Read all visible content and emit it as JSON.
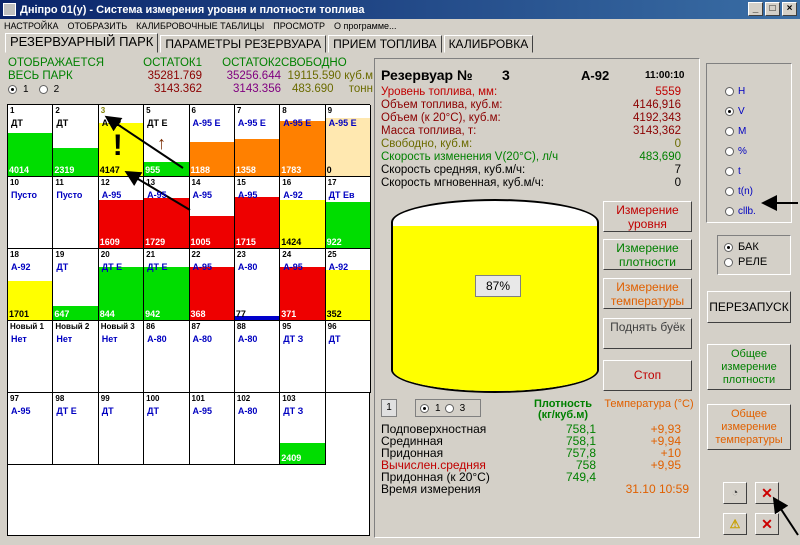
{
  "window": {
    "title": "Дніпро 01(у) - Система измерения уровня и плотности топлива",
    "minimize": "_",
    "maximize": "□",
    "close": "×"
  },
  "menu": [
    "НАСТРОЙКА",
    "ОТОБРАЗИТЬ",
    "КАЛИБРОВОЧНЫЕ ТАБЛИЦЫ",
    "ПРОСМОТР",
    "О программе..."
  ],
  "tabs": [
    "РЕЗЕРВУАРНЫЙ ПАРК",
    "ПАРАМЕТРЫ РЕЗЕРВУАРА",
    "ПРИЕМ ТОПЛИВА",
    "КАЛИБРОВКА"
  ],
  "summary": {
    "label_display": "ОТОБРАЖАЕТСЯ",
    "label_all": "ВЕСЬ ПАРК",
    "h_rest1": "ОСТАТОК1",
    "h_rest2": "ОСТАТОК2",
    "h_free": "СВОБОДНО",
    "radio1": "1",
    "radio2": "2",
    "v1": "35281.769",
    "v2": "35256.644",
    "v3": "19115.590",
    "u1": "куб.м",
    "w1": "3143.362",
    "w2": "3143.356",
    "w3": "483.690",
    "u2": "тонн"
  },
  "tanks": [
    {
      "n": "1",
      "f": "ДТ",
      "v": "4014",
      "fill": 0.6,
      "c": "#00dd00",
      "fc": "#000"
    },
    {
      "n": "2",
      "f": "ДТ",
      "v": "2319",
      "fill": 0.4,
      "c": "#00dd00",
      "fc": "#000"
    },
    {
      "n": "3",
      "f": "А-92",
      "v": "4147",
      "fill": 0.75,
      "c": "#ffff00",
      "fc": "#000",
      "hl": true
    },
    {
      "n": "5",
      "f": "ДТ Е",
      "v": "955",
      "fill": 0.2,
      "c": "#00dd00",
      "fc": "#000"
    },
    {
      "n": "6",
      "f": "А-95 Е",
      "v": "1188",
      "fill": 0.48,
      "c": "#ff8000",
      "fc": "#0000c0"
    },
    {
      "n": "7",
      "f": "А-95 Е",
      "v": "1358",
      "fill": 0.52,
      "c": "#ff8000",
      "fc": "#0000c0"
    },
    {
      "n": "8",
      "f": "А-95 Е",
      "v": "1783",
      "fill": 0.78,
      "c": "#ff8000",
      "fc": "#0000c0"
    },
    {
      "n": "",
      "f": "А-95 Е",
      "v": "",
      "fill": 0.78,
      "c": "#ff8000",
      "fc": "#0000c0",
      "hide": true
    },
    {
      "n": "9",
      "f": "А-95 Е",
      "v": "0",
      "fill": 0.82,
      "c": "#ffe8b0",
      "fc": "#0000c0"
    },
    {
      "n": "10",
      "f": "Пусто",
      "v": "",
      "fill": 0,
      "c": "#fff",
      "fc": "#0000c0"
    },
    {
      "n": "11",
      "f": "Пусто",
      "v": "",
      "fill": 0,
      "c": "#fff",
      "fc": "#0000c0"
    },
    {
      "n": "12",
      "f": "А-95",
      "v": "1609",
      "fill": 0.68,
      "c": "#ee0000",
      "fc": "#0000c0"
    },
    {
      "n": "13",
      "f": "А-95",
      "v": "1729",
      "fill": 0.7,
      "c": "#ee0000",
      "fc": "#0000c0"
    },
    {
      "n": "14",
      "f": "А-95",
      "v": "1005",
      "fill": 0.45,
      "c": "#ee0000",
      "fc": "#0000c0"
    },
    {
      "n": "15",
      "f": "А-95",
      "v": "1715",
      "fill": 0.72,
      "c": "#ee0000",
      "fc": "#0000c0"
    },
    {
      "n": "16",
      "f": "А-92",
      "v": "1424",
      "fill": 0.68,
      "c": "#ffff00",
      "fc": "#0000c0"
    },
    {
      "n": "17",
      "f": "ДТ Ев",
      "v": "922",
      "fill": 0.65,
      "c": "#00dd00",
      "fc": "#0000c0"
    },
    {
      "n": "18",
      "f": "А-92",
      "v": "1701",
      "fill": 0.55,
      "c": "#ffff00",
      "fc": "#0000c0"
    },
    {
      "n": "19",
      "f": "ДТ",
      "v": "647",
      "fill": 0.2,
      "c": "#00dd00",
      "fc": "#0000c0"
    },
    {
      "n": "20",
      "f": "ДТ Е",
      "v": "844",
      "fill": 0.75,
      "c": "#00dd00",
      "fc": "#0000c0"
    },
    {
      "n": "21",
      "f": "ДТ Е",
      "v": "942",
      "fill": 0.75,
      "c": "#00dd00",
      "fc": "#0000c0"
    },
    {
      "n": "22",
      "f": "А-95",
      "v": "368",
      "fill": 0.75,
      "c": "#ee0000",
      "fc": "#0000c0"
    },
    {
      "n": "23",
      "f": "А-80",
      "v": "77",
      "fill": 0.06,
      "c": "#0000cc",
      "fc": "#0000c0"
    },
    {
      "n": "24",
      "f": "А-95",
      "v": "371",
      "fill": 0.75,
      "c": "#ee0000",
      "fc": "#0000c0"
    },
    {
      "n": "25",
      "f": "А-92",
      "v": "352",
      "fill": 0.7,
      "c": "#ffff00",
      "fc": "#0000c0"
    },
    {
      "n": "Новый 1",
      "f": "Нет",
      "v": "",
      "fill": 0,
      "c": "#fff",
      "fc": "#0000c0"
    },
    {
      "n": "Новый 2",
      "f": "Нет",
      "v": "",
      "fill": 0,
      "c": "#fff",
      "fc": "#0000c0"
    },
    {
      "n": "Новый 3",
      "f": "Нет",
      "v": "",
      "fill": 0,
      "c": "#fff",
      "fc": "#0000c0"
    },
    {
      "n": "86",
      "f": "А-80",
      "v": "",
      "fill": 0,
      "c": "#fff",
      "fc": "#0000c0"
    },
    {
      "n": "87",
      "f": "А-80",
      "v": "",
      "fill": 0,
      "c": "#fff",
      "fc": "#0000c0"
    },
    {
      "n": "88",
      "f": "А-80",
      "v": "",
      "fill": 0,
      "c": "#fff",
      "fc": "#0000c0"
    },
    {
      "n": "95",
      "f": "ДТ З",
      "v": "",
      "fill": 0,
      "c": "#fff",
      "fc": "#0000c0"
    },
    {
      "n": "96",
      "f": "ДТ",
      "v": "",
      "fill": 0,
      "c": "#fff",
      "fc": "#0000c0"
    },
    {
      "n": "97",
      "f": "А-95",
      "v": "",
      "fill": 0,
      "c": "#fff",
      "fc": "#0000c0"
    },
    {
      "n": "98",
      "f": "ДТ Е",
      "v": "",
      "fill": 0,
      "c": "#fff",
      "fc": "#0000c0"
    },
    {
      "n": "99",
      "f": "ДТ",
      "v": "",
      "fill": 0,
      "c": "#fff",
      "fc": "#0000c0"
    },
    {
      "n": "100",
      "f": "ДТ",
      "v": "",
      "fill": 0,
      "c": "#fff",
      "fc": "#0000c0"
    },
    {
      "n": "101",
      "f": "А-95",
      "v": "",
      "fill": 0,
      "c": "#fff",
      "fc": "#0000c0"
    },
    {
      "n": "102",
      "f": "А-80",
      "v": "",
      "fill": 0,
      "c": "#fff",
      "fc": "#0000c0"
    },
    {
      "n": "103",
      "f": "ДТ З",
      "v": "2409",
      "fill": 0.3,
      "c": "#00dd00",
      "fc": "#0000c0"
    }
  ],
  "reservoir": {
    "title": "Резервуар №",
    "number": "3",
    "fuel": "А-92",
    "time": "11:00:10",
    "params": [
      {
        "label": "Уровень топлива, мм:",
        "value": "5559",
        "color": "#c00000"
      },
      {
        "label": "Объем топлива, куб.м:",
        "value": "4146,916",
        "color": "#8b0000"
      },
      {
        "label": "Объем (к 20°С), куб.м:",
        "value": "4192,343",
        "color": "#8b0000"
      },
      {
        "label": "Масса топлива, т:",
        "value": "3143,362",
        "color": "#8b0000"
      },
      {
        "label": "Свободно, куб.м:",
        "value": "0",
        "color": "#6b6b00"
      },
      {
        "label": "Скорость изменения V(20°С), л/ч",
        "value": "483,690",
        "color": "#008000"
      },
      {
        "label": "Скорость средняя, куб.м/ч:",
        "value": "7",
        "color": "#000"
      },
      {
        "label": "Скорость мгновенная, куб.м/ч:",
        "value": "0",
        "color": "#000"
      }
    ],
    "fill_fraction": 0.87,
    "percent": "87%"
  },
  "buttons": {
    "level": "Измерение уровня",
    "density": "Измерение плотности",
    "temp": "Измерение температуры",
    "float": "Поднять буёк",
    "stop": "Стоп"
  },
  "density": {
    "box": "1",
    "r1": "1",
    "r2": "3",
    "h_dens": "Плотность (кг/куб.м)",
    "h_temp": "Температура (°С)",
    "rows": [
      {
        "label": "Подповерхностная",
        "d": "758,1",
        "t": "+9,93",
        "lc": "#000"
      },
      {
        "label": "Срединная",
        "d": "758,1",
        "t": "+9,94",
        "lc": "#000"
      },
      {
        "label": "Придонная",
        "d": "757,8",
        "t": "+10",
        "lc": "#000"
      },
      {
        "label": "Вычислен.средняя",
        "d": "758",
        "t": "+9,95",
        "lc": "#c00000"
      },
      {
        "label": "Придонная (к 20°С)",
        "d": "749,4",
        "t": "",
        "lc": "#000"
      },
      {
        "label": "Время измерения",
        "d": "",
        "t": "31.10 10:59",
        "lc": "#000"
      }
    ]
  },
  "units": [
    "H",
    "V",
    "M",
    "%",
    "t",
    "t(n)",
    "cllb."
  ],
  "mode": {
    "bak": "БАК",
    "rele": "РЕЛЕ"
  },
  "right_buttons": {
    "restart": "ПЕРЕЗАПУСК",
    "common_density": "Общее измерение плотности",
    "common_temp": "Общее измерение температуры"
  },
  "colors": {
    "accent_blue": "#0a246a",
    "red": "#ee0000",
    "yellow": "#ffff00",
    "green": "#00dd00",
    "orange": "#ff8000"
  }
}
